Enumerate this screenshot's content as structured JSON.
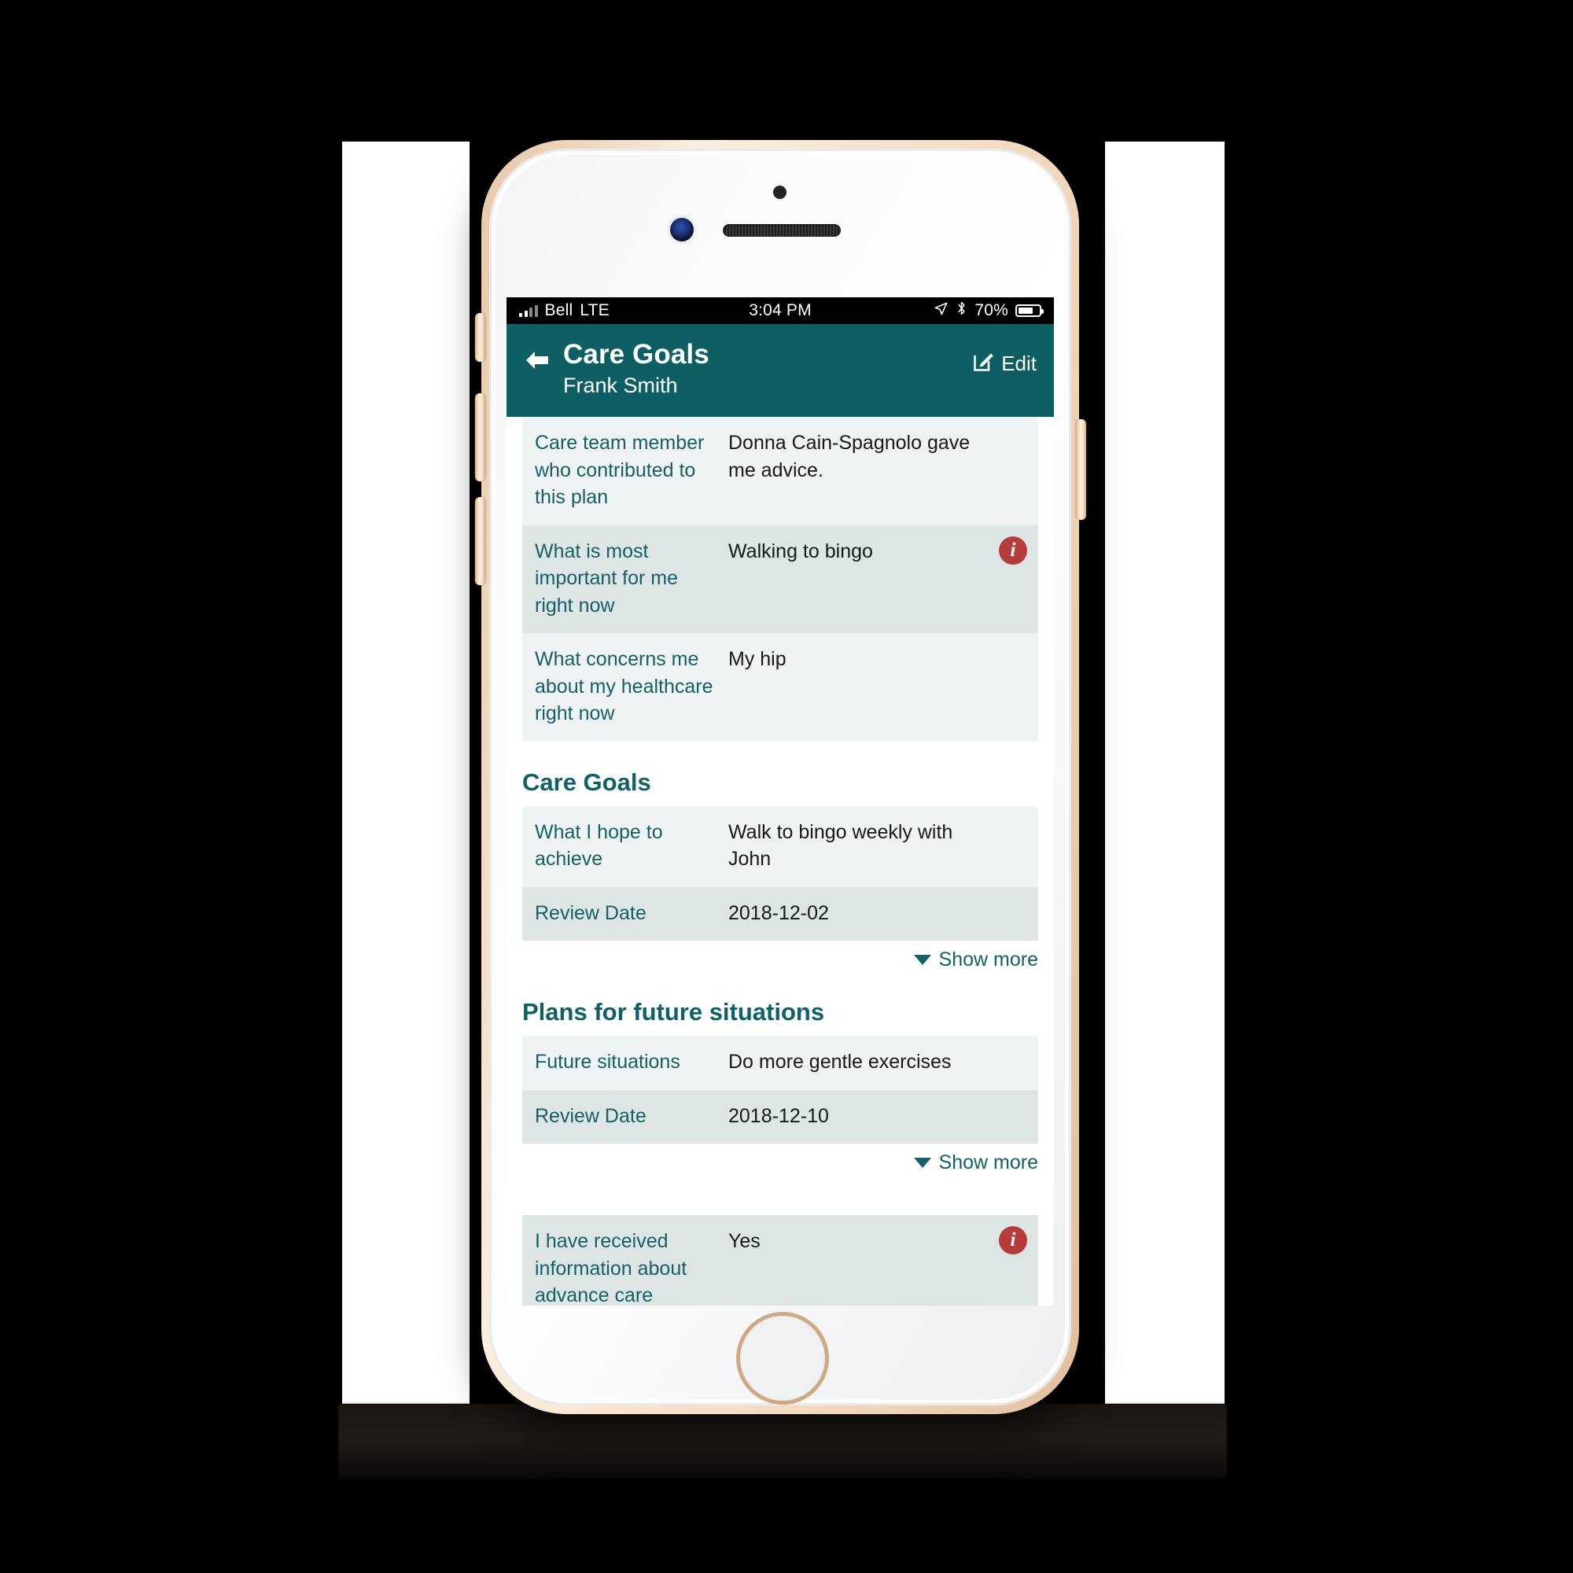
{
  "status_bar": {
    "carrier": "Bell",
    "network": "LTE",
    "time": "3:04 PM",
    "battery_percent": "70%",
    "icons": [
      "signal-bars-icon",
      "location-arrow-icon",
      "bluetooth-icon",
      "battery-icon"
    ]
  },
  "header": {
    "back_icon": "back-arrow-icon",
    "title": "Care Goals",
    "subtitle": "Frank Smith",
    "edit_icon": "edit-pencil-icon",
    "edit_label": "Edit",
    "background_color": "#0d5f63"
  },
  "top_rows": [
    {
      "label": "Care team member who contributed to this plan",
      "value": "Donna Cain-Spagnolo gave me advice.",
      "info": false
    },
    {
      "label": "What is most important for me right now",
      "value": "Walking to bingo",
      "info": true
    },
    {
      "label": "What concerns me about my healthcare right now",
      "value": "My hip",
      "info": false
    }
  ],
  "sections": [
    {
      "title": "Care Goals",
      "rows": [
        {
          "label": "What I hope to achieve",
          "value": "Walk to bingo weekly with John"
        },
        {
          "label": "Review Date",
          "value": "2018-12-02"
        }
      ],
      "show_more_label": "Show more"
    },
    {
      "title": "Plans for future situations",
      "rows": [
        {
          "label": "Future situations",
          "value": "Do more gentle exercises"
        },
        {
          "label": "Review Date",
          "value": "2018-12-10"
        }
      ],
      "show_more_label": "Show more"
    }
  ],
  "bottom_rows": [
    {
      "label": "I have received information about advance care planning",
      "value": "Yes",
      "info": true
    }
  ],
  "colors": {
    "header_teal": "#0d5f63",
    "label_teal": "#156067",
    "row_light": "#eff3f3",
    "row_dark": "#dde5e5",
    "info_red": "#b63c3c"
  }
}
